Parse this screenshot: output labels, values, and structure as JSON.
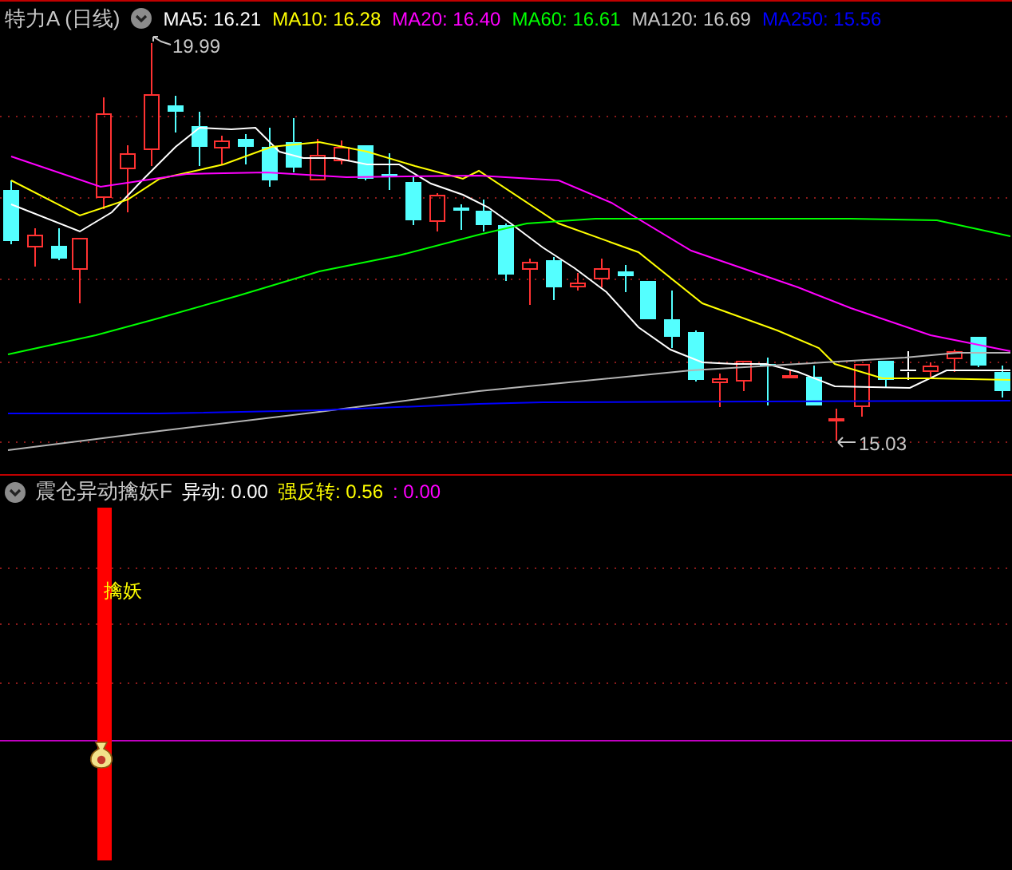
{
  "chart_header": {
    "title": "特力A (日线)",
    "indicators": [
      {
        "text": "MA5: 16.21",
        "color": "#ffffff"
      },
      {
        "text": "MA10: 16.28",
        "color": "#ffff00"
      },
      {
        "text": "MA20: 16.40",
        "color": "#ff00ff"
      },
      {
        "text": "MA60: 16.61",
        "color": "#00ff00"
      },
      {
        "text": "MA120: 16.69",
        "color": "#c8c8c8"
      },
      {
        "text": "MA250: 15.56",
        "color": "#0000ff"
      }
    ]
  },
  "price_chart": {
    "high_label": "19.99",
    "low_label": "15.03"
  },
  "indicator_header": {
    "title": "震仓异动擒妖F",
    "values": [
      {
        "text": "异动: 0.00",
        "color": "#ffffff"
      },
      {
        "text": "强反转: 0.56",
        "color": "#ffff00"
      },
      {
        "text": " : 0.00",
        "color": "#ff00ff"
      }
    ]
  },
  "indicator_chart": {
    "signal_label": "擒妖"
  }
}
